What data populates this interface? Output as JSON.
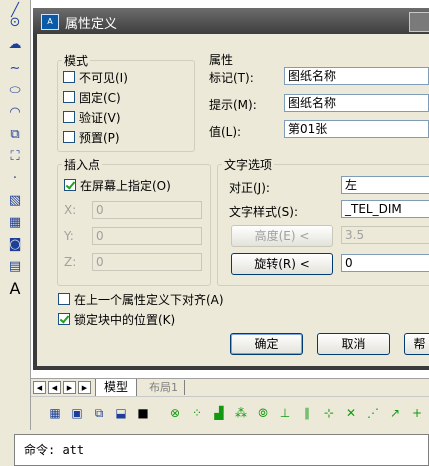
{
  "dialog": {
    "title": "属性定义"
  },
  "mode": {
    "title": "模式",
    "invisible": {
      "label": "不可见(I)",
      "checked": false
    },
    "constant": {
      "label": "固定(C)",
      "checked": false
    },
    "verify": {
      "label": "验证(V)",
      "checked": false
    },
    "preset": {
      "label": "预置(P)",
      "checked": false
    }
  },
  "attribute": {
    "title": "属性",
    "tag": {
      "label": "标记(T):",
      "value": "图纸名称"
    },
    "prompt": {
      "label": "提示(M):",
      "value": "图纸名称"
    },
    "default": {
      "label": "值(L):",
      "value": "第01张"
    }
  },
  "insertion": {
    "title": "插入点",
    "specify": {
      "label": "在屏幕上指定(O)",
      "checked": true
    },
    "x": {
      "label": "X:",
      "value": "0"
    },
    "y": {
      "label": "Y:",
      "value": "0"
    },
    "z": {
      "label": "Z:",
      "value": "0"
    }
  },
  "text_options": {
    "title": "文字选项",
    "justify": {
      "label": "对正(J):",
      "value": "左"
    },
    "style": {
      "label": "文字样式(S):",
      "value": "_TEL_DIM"
    },
    "height": {
      "button": "高度(E) <",
      "value": "3.5"
    },
    "rotation": {
      "button": "旋转(R) <",
      "value": "0"
    }
  },
  "align_below": {
    "label": "在上一个属性定义下对齐(A)",
    "checked": false
  },
  "lock_position": {
    "label": "锁定块中的位置(K)",
    "checked": true
  },
  "buttons": {
    "ok": "确定",
    "cancel": "取消",
    "help": "帮"
  },
  "layout_tabs": {
    "model": "模型",
    "layout1": "布局1"
  },
  "command": {
    "prompt": "命令: att"
  },
  "colors": {
    "title_bar": "#3e3e3e",
    "dialog_bg": "#ece9d8",
    "check_mark": "#21a121"
  }
}
